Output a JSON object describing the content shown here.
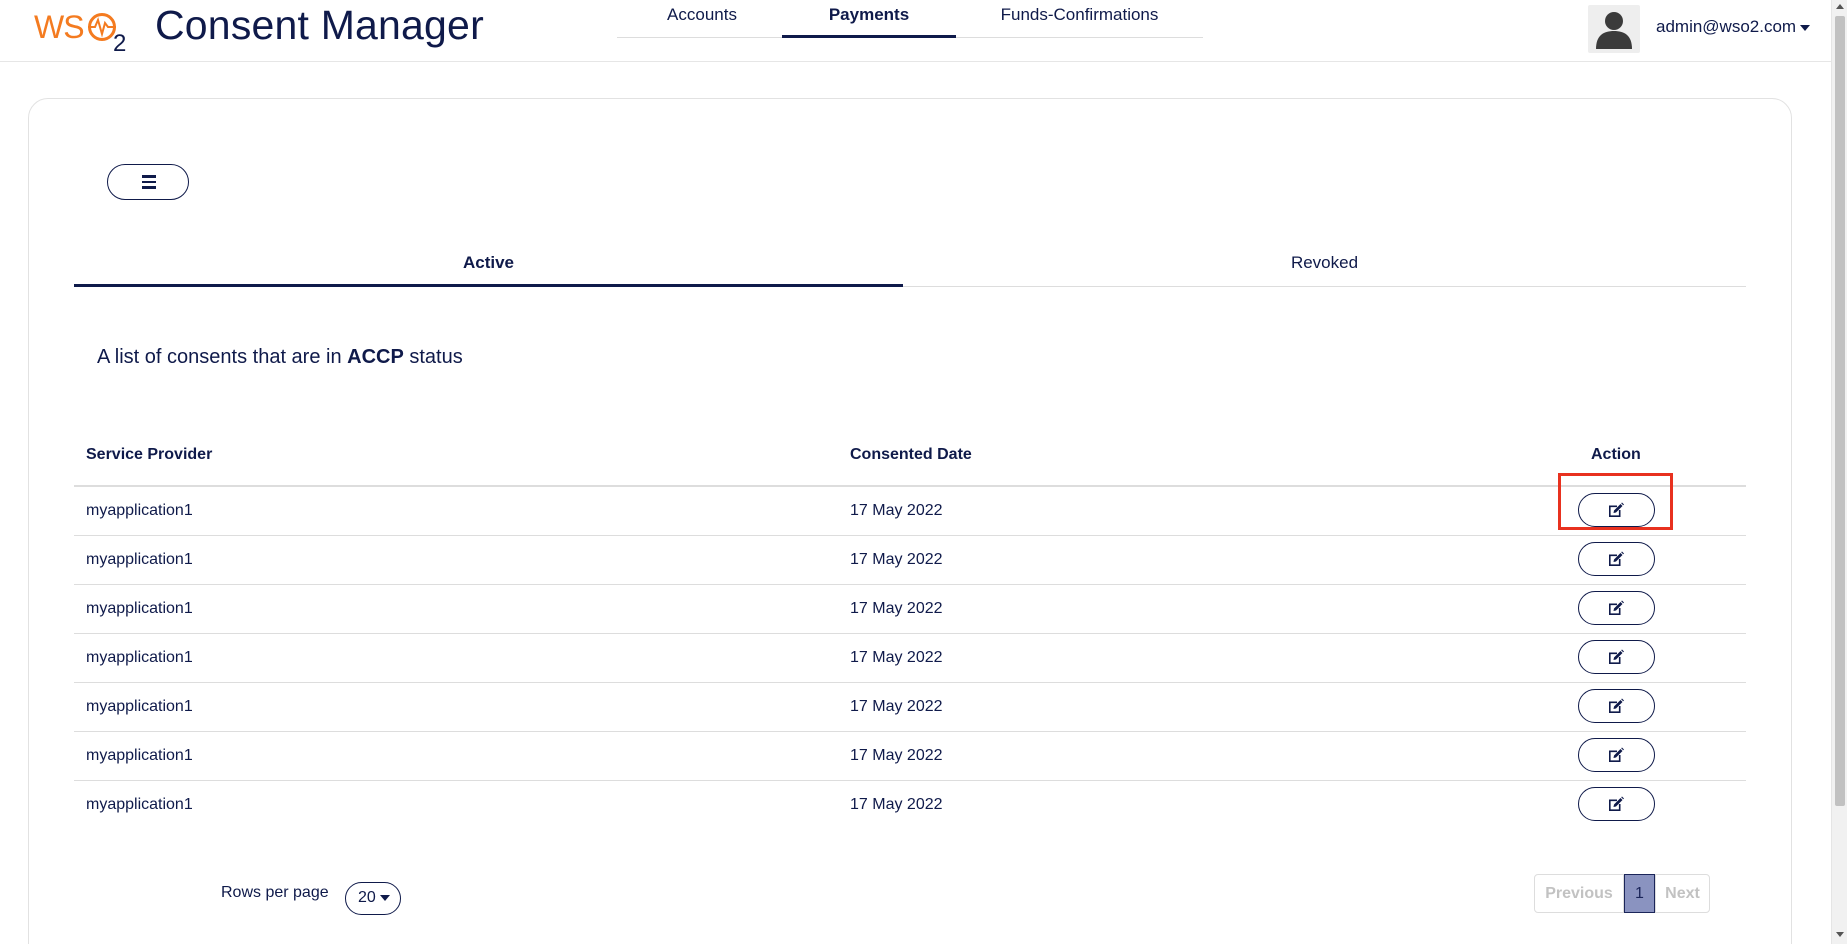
{
  "header": {
    "logo_text": "WSO2",
    "app_title": "Consent Manager",
    "nav_tabs": [
      {
        "label": "Accounts",
        "active": false
      },
      {
        "label": "Payments",
        "active": true
      },
      {
        "label": "Funds-Confirmations",
        "active": false
      }
    ],
    "user_email": "admin@wso2.com",
    "avatar_icon": "user-silhouette-icon"
  },
  "toolbar": {
    "menu_icon": "hamburger-menu-icon"
  },
  "status_tabs": [
    {
      "label": "Active",
      "active": true
    },
    {
      "label": "Revoked",
      "active": false
    }
  ],
  "description": {
    "prefix": "A list of consents that are in ",
    "status": "ACCP",
    "suffix": " status"
  },
  "table": {
    "columns": [
      "Service Provider",
      "Consented Date",
      "Action"
    ],
    "rows": [
      {
        "service_provider": "myapplication1",
        "consented_date": "17 May 2022"
      },
      {
        "service_provider": "myapplication1",
        "consented_date": "17 May 2022"
      },
      {
        "service_provider": "myapplication1",
        "consented_date": "17 May 2022"
      },
      {
        "service_provider": "myapplication1",
        "consented_date": "17 May 2022"
      },
      {
        "service_provider": "myapplication1",
        "consented_date": "17 May 2022"
      },
      {
        "service_provider": "myapplication1",
        "consented_date": "17 May 2022"
      },
      {
        "service_provider": "myapplication1",
        "consented_date": "17 May 2022"
      }
    ],
    "action_icon": "edit-icon"
  },
  "pagination": {
    "rows_per_page_label": "Rows per page",
    "rows_per_page_value": "20",
    "previous_label": "Previous",
    "current_page": "1",
    "next_label": "Next"
  },
  "colors": {
    "primary": "#0f1a4a",
    "highlight": "#e8311f",
    "logo_orange": "#f47b20",
    "current_page_bg": "#8a93c0"
  }
}
